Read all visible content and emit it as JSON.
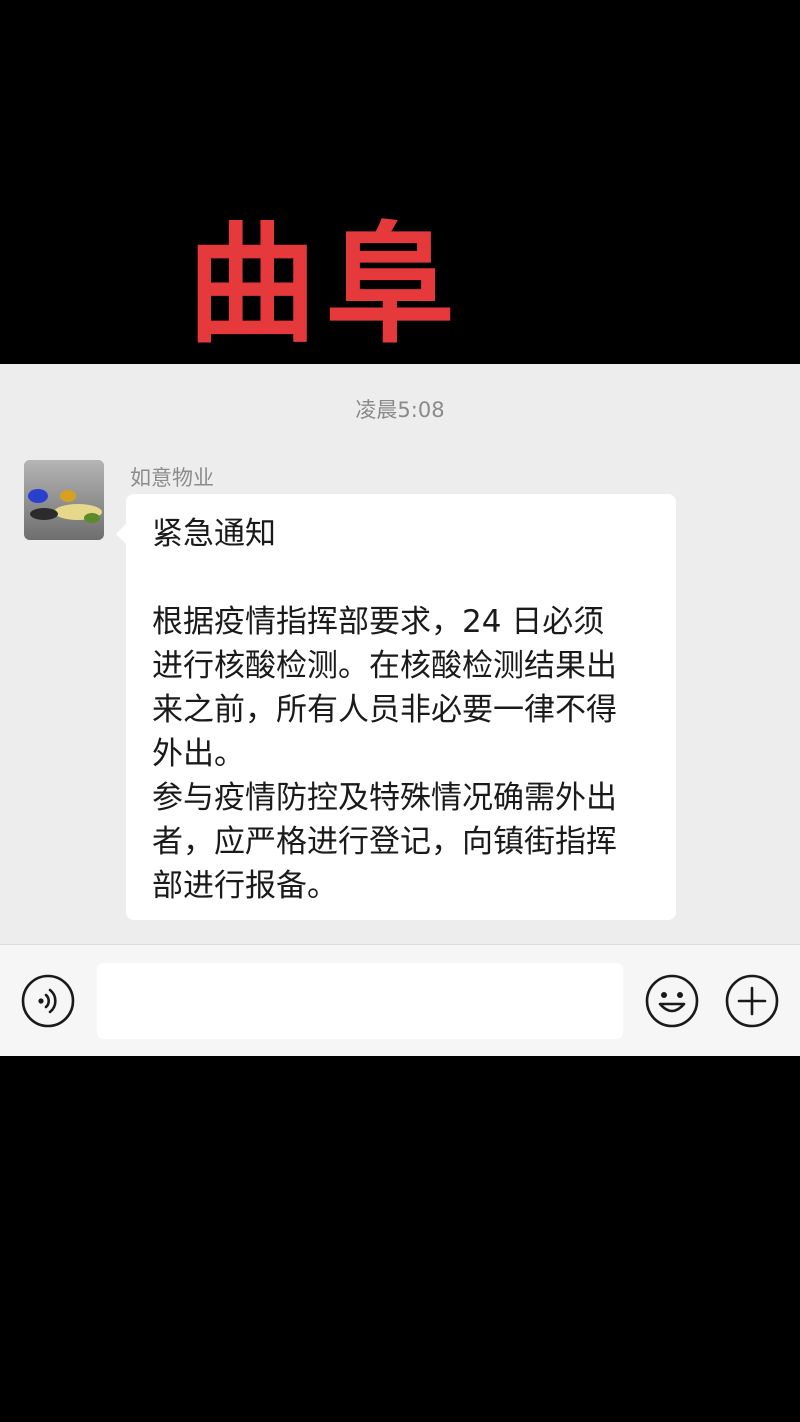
{
  "overlay": {
    "title": "曲阜",
    "color": "#e5393b"
  },
  "chat": {
    "timestamp": "凌晨5:08",
    "sender": {
      "name": "如意物业",
      "avatar_icon": "avatar-image"
    },
    "message": {
      "lines": [
        "紧急通知",
        "",
        "根据疫情指挥部要求，24 日必须",
        "进行核酸检测。在核酸检测结果出",
        "来之前，所有人员非必要一律不得",
        "外出。",
        "参与疫情防控及特殊情况确需外出",
        "者，应严格进行登记，向镇街指挥",
        "部进行报备。"
      ]
    }
  },
  "input_bar": {
    "voice_icon": "voice-icon",
    "input_value": "",
    "emoji_icon": "emoji-icon",
    "plus_icon": "plus-icon"
  }
}
